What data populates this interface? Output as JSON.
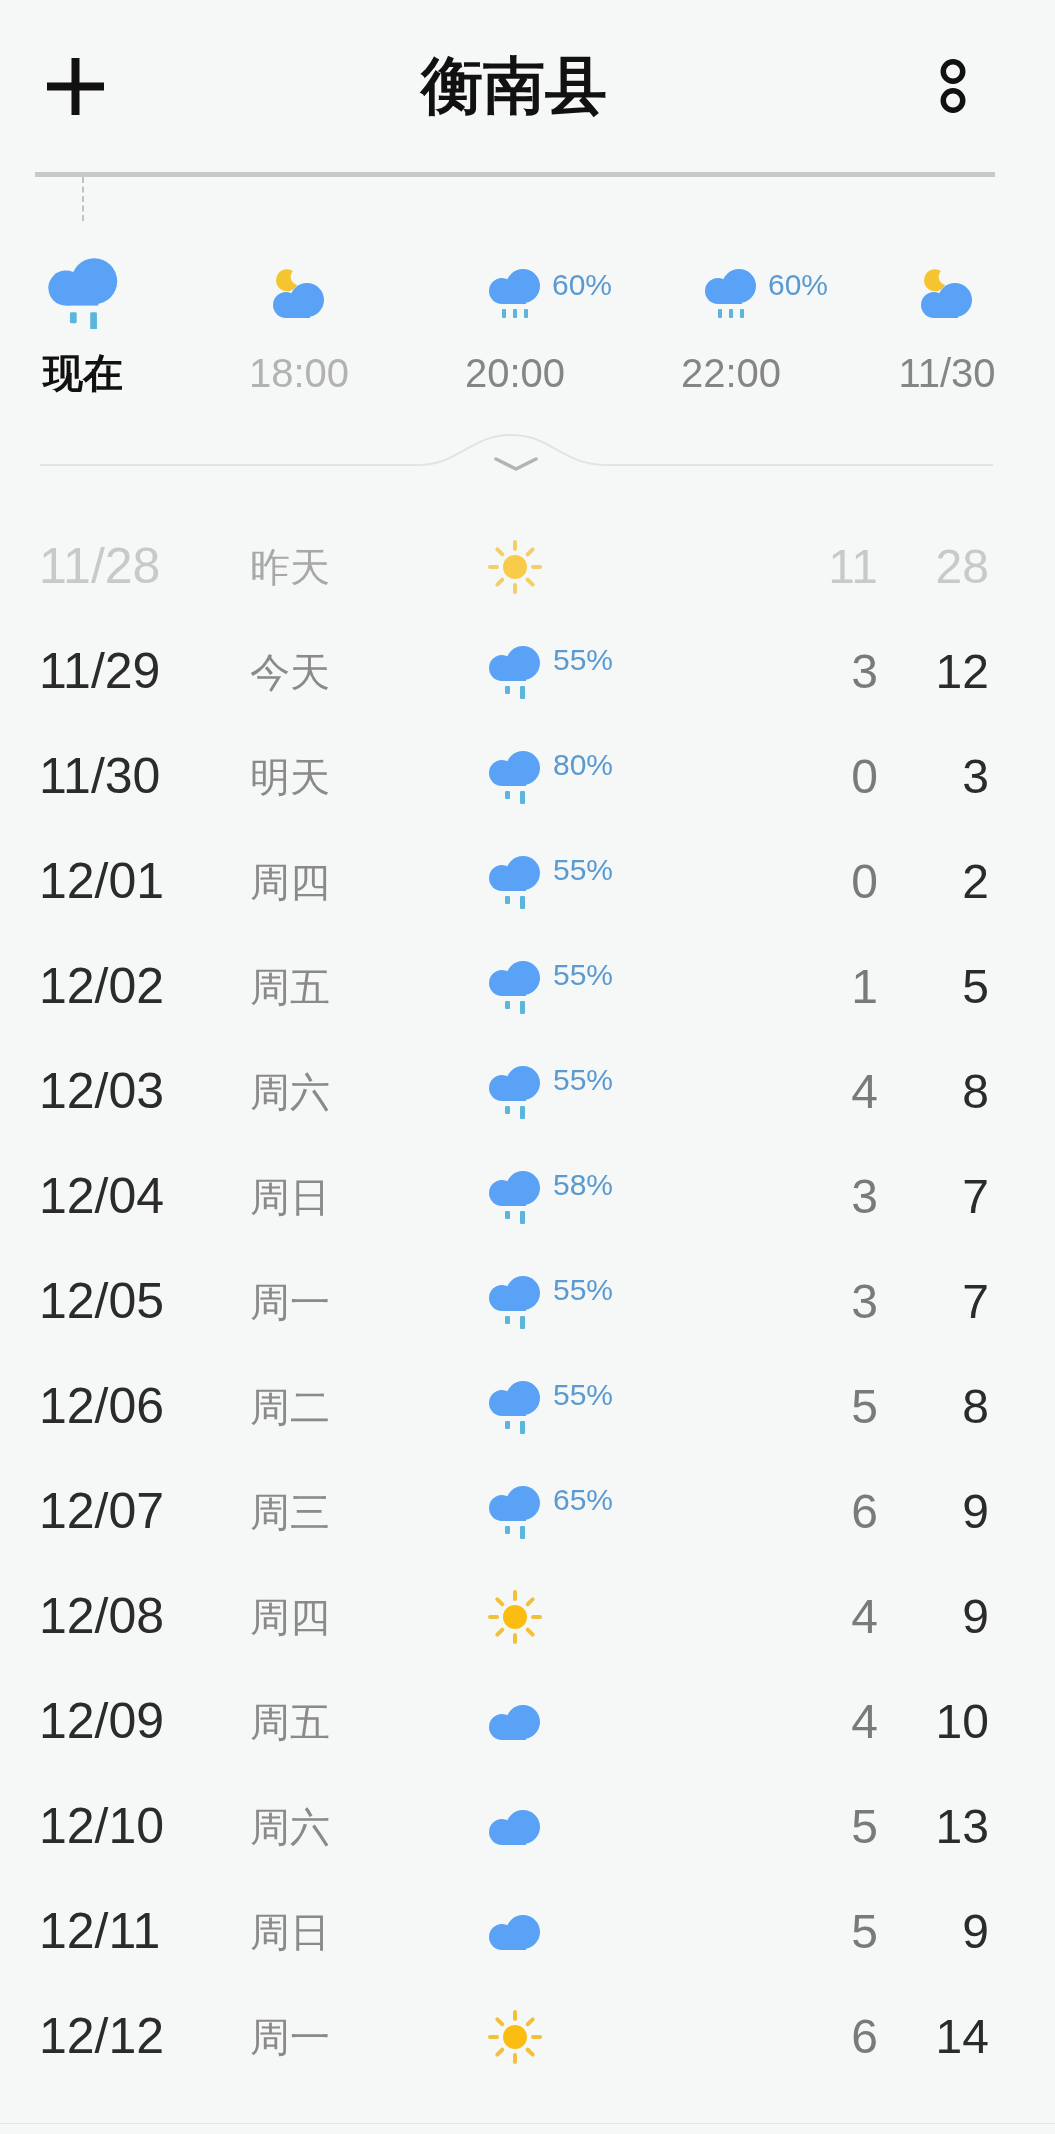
{
  "header": {
    "title": "衡南县"
  },
  "hourly": [
    {
      "time": "现在",
      "kind": "rain",
      "selected": true,
      "dimmed": false
    },
    {
      "time": "18:00",
      "kind": "night-cloudy",
      "selected": false,
      "dimmed": true
    },
    {
      "time": "20:00",
      "kind": "light-rain",
      "precip": "60%",
      "selected": false,
      "dimmed": false
    },
    {
      "time": "22:00",
      "kind": "light-rain",
      "precip": "60%",
      "selected": false,
      "dimmed": false
    },
    {
      "time": "11/30",
      "kind": "night-cloudy",
      "selected": false,
      "dimmed": false
    }
  ],
  "daily": [
    {
      "date": "11/28",
      "weekday": "昨天",
      "kind": "sunny",
      "low": "11",
      "high": "28",
      "past": true
    },
    {
      "date": "11/29",
      "weekday": "今天",
      "kind": "rain",
      "precip": "55%",
      "low": "3",
      "high": "12",
      "past": false
    },
    {
      "date": "11/30",
      "weekday": "明天",
      "kind": "rain",
      "precip": "80%",
      "low": "0",
      "high": "3",
      "past": false
    },
    {
      "date": "12/01",
      "weekday": "周四",
      "kind": "rain",
      "precip": "55%",
      "low": "0",
      "high": "2",
      "past": false
    },
    {
      "date": "12/02",
      "weekday": "周五",
      "kind": "rain",
      "precip": "55%",
      "low": "1",
      "high": "5",
      "past": false
    },
    {
      "date": "12/03",
      "weekday": "周六",
      "kind": "rain",
      "precip": "55%",
      "low": "4",
      "high": "8",
      "past": false
    },
    {
      "date": "12/04",
      "weekday": "周日",
      "kind": "rain",
      "precip": "58%",
      "low": "3",
      "high": "7",
      "past": false
    },
    {
      "date": "12/05",
      "weekday": "周一",
      "kind": "rain",
      "precip": "55%",
      "low": "3",
      "high": "7",
      "past": false
    },
    {
      "date": "12/06",
      "weekday": "周二",
      "kind": "rain",
      "precip": "55%",
      "low": "5",
      "high": "8",
      "past": false
    },
    {
      "date": "12/07",
      "weekday": "周三",
      "kind": "rain",
      "precip": "65%",
      "low": "6",
      "high": "9",
      "past": false
    },
    {
      "date": "12/08",
      "weekday": "周四",
      "kind": "sunny",
      "low": "4",
      "high": "9",
      "past": false
    },
    {
      "date": "12/09",
      "weekday": "周五",
      "kind": "cloudy",
      "low": "4",
      "high": "10",
      "past": false
    },
    {
      "date": "12/10",
      "weekday": "周六",
      "kind": "cloudy",
      "low": "5",
      "high": "13",
      "past": false
    },
    {
      "date": "12/11",
      "weekday": "周日",
      "kind": "cloudy",
      "low": "5",
      "high": "9",
      "past": false
    },
    {
      "date": "12/12",
      "weekday": "周一",
      "kind": "sunny",
      "low": "6",
      "high": "14",
      "past": false
    }
  ]
}
